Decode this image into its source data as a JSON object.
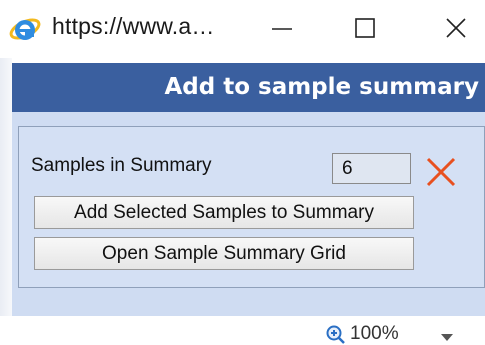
{
  "window": {
    "title": "https://www.a…",
    "icon": "internet-explorer-icon",
    "controls": [
      "minimize-icon",
      "maximize-icon",
      "close-icon"
    ]
  },
  "header": {
    "title": "Add to sample summary"
  },
  "panel": {
    "samples_label": "Samples in Summary",
    "samples_count": "6",
    "remove_icon": "red-x-icon",
    "add_button_label": "Add Selected Samples to Summary",
    "open_button_label": "Open Sample Summary Grid"
  },
  "status": {
    "zoom_level": "100%",
    "zoom_icon": "zoom-magnifier-icon",
    "dropdown_icon": "chevron-down-icon"
  },
  "colors": {
    "header_bg": "#3a5f9f",
    "panel_bg": "#cfdcf2",
    "remove_x": "#e8501f"
  }
}
